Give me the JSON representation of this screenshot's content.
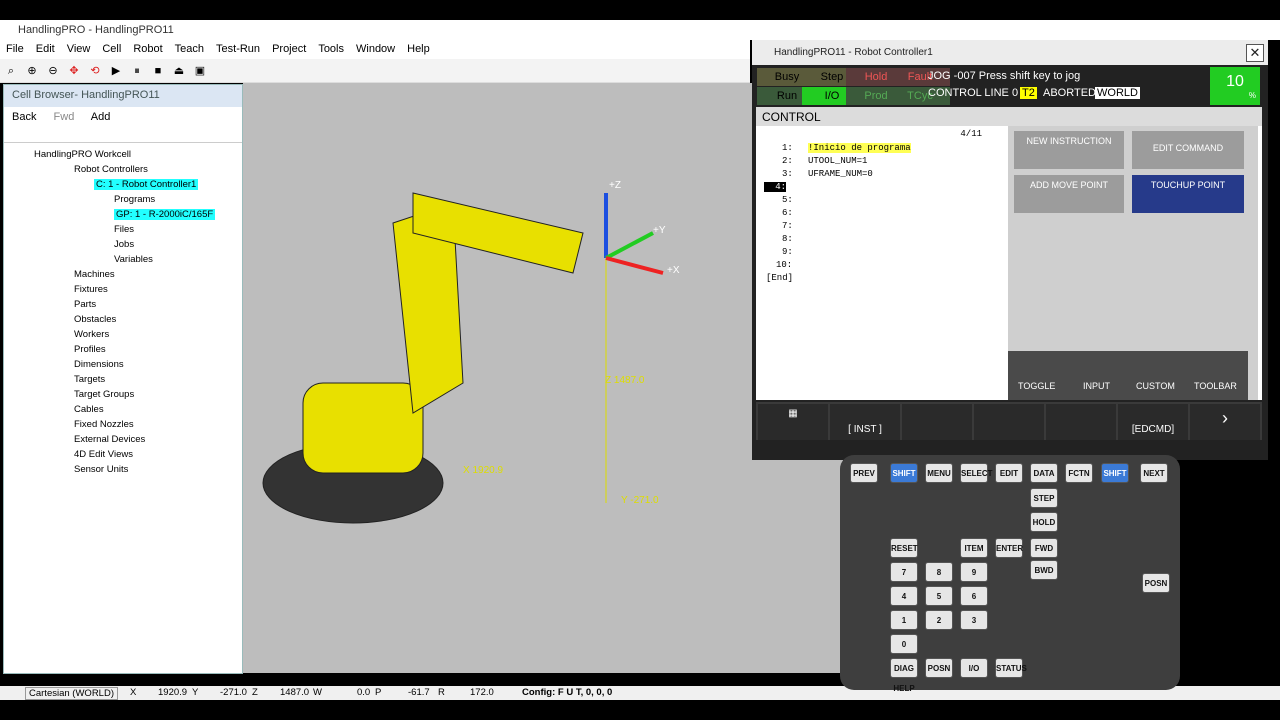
{
  "app": {
    "title": "HandlingPRO - HandlingPRO11"
  },
  "menu": [
    "File",
    "Edit",
    "View",
    "Cell",
    "Robot",
    "Teach",
    "Test-Run",
    "Project",
    "Tools",
    "Window",
    "Help"
  ],
  "browser": {
    "title": "Cell Browser- HandlingPRO11",
    "back": "Back",
    "fwd": "Fwd",
    "add": "Add",
    "tree": [
      "HandlingPRO Workcell",
      "Robot Controllers",
      "C: 1 - Robot Controller1",
      "Programs",
      "GP: 1 - R-2000iC/165F",
      "Files",
      "Jobs",
      "Variables",
      "Machines",
      "Fixtures",
      "Parts",
      "Obstacles",
      "Workers",
      "Profiles",
      "Dimensions",
      "Targets",
      "Target Groups",
      "Cables",
      "Fixed Nozzles",
      "External Devices",
      "4D Edit Views",
      "Sensor Units"
    ]
  },
  "viewport": {
    "z_label": "Z 1487.0",
    "x_label": "X 1920.9",
    "y_label": "Y -271.0",
    "axis_z": "+Z",
    "axis_y": "+Y",
    "axis_x": "+X"
  },
  "status": {
    "mode": "Cartesian (WORLD)",
    "x": "1920.9",
    "y": "-271.0",
    "z": "1487.0",
    "w": "0.0",
    "p": "-61.7",
    "r": "172.0",
    "config": "Config: F U T, 0, 0, 0"
  },
  "pendant": {
    "title": "HandlingPRO11 - Robot Controller1",
    "leds": [
      "Busy",
      "Step",
      "Hold",
      "Fault",
      "Run",
      "I/O",
      "Prod",
      "TCyc"
    ],
    "msg1": "JOG -007 Press shift key to jog",
    "msg2": "CONTROL LINE 0",
    "t2": "T2",
    "aborted": "ABORTED",
    "world": "WORLD",
    "override": "10",
    "override_unit": "%",
    "screen_title": "CONTROL",
    "line_pos": "4/11",
    "lines": [
      "1:",
      "2:",
      "3:",
      "4:",
      "5:",
      "6:",
      "7:",
      "8:",
      "9:",
      "10:"
    ],
    "code": [
      "!Inicio de programa",
      "UTOOL_NUM=1",
      "UFRAME_NUM=0"
    ],
    "end": "[End]",
    "buttons": [
      "NEW INSTRUCTION",
      "EDIT COMMAND",
      "ADD MOVE POINT",
      "TOUCHUP POINT"
    ],
    "toolbar": [
      "TOGGLE",
      "INPUT",
      "CUSTOM",
      "TOOLBAR"
    ],
    "fkeys": [
      "[ INST ]",
      "[EDCMD]"
    ]
  },
  "keypad": [
    "PREV",
    "SHIFT",
    "MENU",
    "SELECT",
    "EDIT",
    "DATA",
    "FCTN",
    "SHIFT",
    "NEXT",
    "STEP",
    "HOLD",
    "FWD",
    "BWD",
    "RESET",
    "ITEM",
    "ENTER",
    "7",
    "8",
    "9",
    "4",
    "5",
    "6",
    "1",
    "2",
    "3",
    "0",
    "DIAG HELP",
    "POSN",
    "I/O",
    "STATUS",
    "POSN"
  ]
}
